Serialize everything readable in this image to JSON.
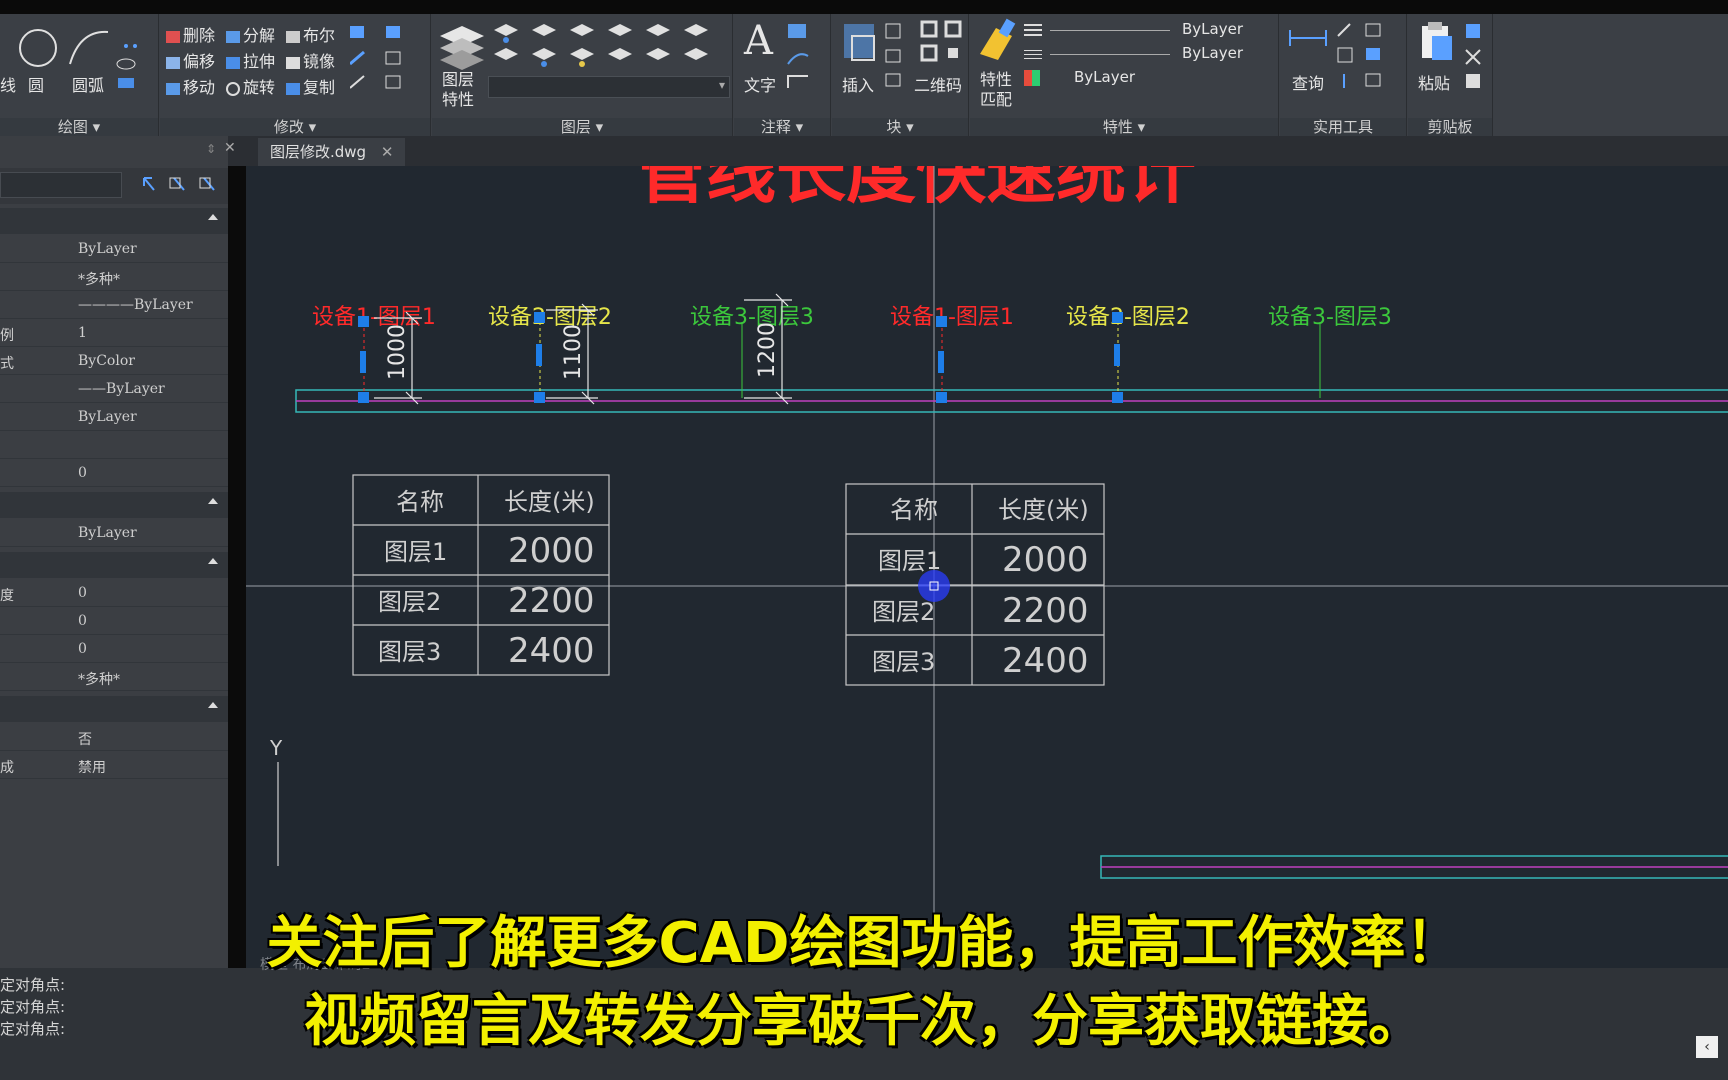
{
  "ribbon": {
    "draw": {
      "title": "绘图",
      "items": [
        "线",
        "圆",
        "圆弧"
      ]
    },
    "modify": {
      "title": "修改",
      "row1": [
        "删除",
        "分解",
        "布尔"
      ],
      "row2": [
        "偏移",
        "拉伸",
        "镜像"
      ],
      "row3": [
        "移动",
        "旋转",
        "复制"
      ]
    },
    "layer": {
      "title": "图层",
      "button": "图层\n特性"
    },
    "annotation": {
      "title": "注释",
      "button": "文字"
    },
    "block": {
      "title": "块",
      "insert": "插入",
      "qrcode": "二维码"
    },
    "properties": {
      "title": "特性",
      "match": "特性\n匹配",
      "values": [
        "ByLayer",
        "ByLayer",
        "ByLayer"
      ]
    },
    "utilities": {
      "title": "实用工具",
      "query": "查询"
    },
    "clipboard": {
      "title": "剪贴板",
      "paste": "粘贴"
    }
  },
  "tabs": [
    {
      "label": "图层修改.dwg"
    }
  ],
  "properties_panel": {
    "rows": [
      {
        "k": "",
        "v": "ByLayer"
      },
      {
        "k": "",
        "v": "*多种*"
      },
      {
        "k": "",
        "v": "————ByLayer"
      },
      {
        "k": "例",
        "v": "1"
      },
      {
        "k": "式",
        "v": "ByColor"
      },
      {
        "k": "",
        "v": "——ByLayer"
      },
      {
        "k": "",
        "v": "ByLayer"
      },
      {
        "k": "",
        "v": ""
      },
      {
        "k": "",
        "v": "0"
      }
    ],
    "row_b": {
      "k": "",
      "v": "ByLayer"
    },
    "rows_c": [
      {
        "k": "度",
        "v": "0"
      },
      {
        "k": "",
        "v": "0"
      },
      {
        "k": "",
        "v": "0"
      },
      {
        "k": "",
        "v": "*多种*"
      }
    ],
    "rows_d": [
      {
        "k": "",
        "v": "否"
      },
      {
        "k": "成",
        "v": "禁用"
      }
    ]
  },
  "drawing": {
    "title": "管线长度快速统计",
    "equipment_labels": [
      {
        "text": "设备1-图层1",
        "color": "#ff2a2a"
      },
      {
        "text": "设备2-图层2",
        "color": "#e6e64a"
      },
      {
        "text": "设备3-图层3",
        "color": "#3cc83c"
      },
      {
        "text": "设备1-图层1",
        "color": "#ff2a2a"
      },
      {
        "text": "设备2-图层2",
        "color": "#e6e64a"
      },
      {
        "text": "设备3-图层3",
        "color": "#3cc83c"
      }
    ],
    "dimensions": [
      "1000",
      "1100",
      "1200"
    ],
    "tables": [
      {
        "header": [
          "名称",
          "长度(米)"
        ],
        "rows": [
          [
            "图层1",
            "2000"
          ],
          [
            "图层2",
            "2200"
          ],
          [
            "图层3",
            "2400"
          ]
        ]
      },
      {
        "header": [
          "名称",
          "长度(米)"
        ],
        "rows": [
          [
            "图层1",
            "2000"
          ],
          [
            "图层2",
            "2200"
          ],
          [
            "图层3",
            "2400"
          ]
        ]
      }
    ],
    "ucs_label": "Y"
  },
  "command_line": [
    "定对角点:",
    "定对角点:",
    "定对角点:"
  ],
  "layout_tabs": "模型  布局1  布局2",
  "subtitles": [
    "关注后了解更多CAD绘图功能，提高工作效率！",
    "视频留言及转发分享破千次，分享获取链接。"
  ]
}
